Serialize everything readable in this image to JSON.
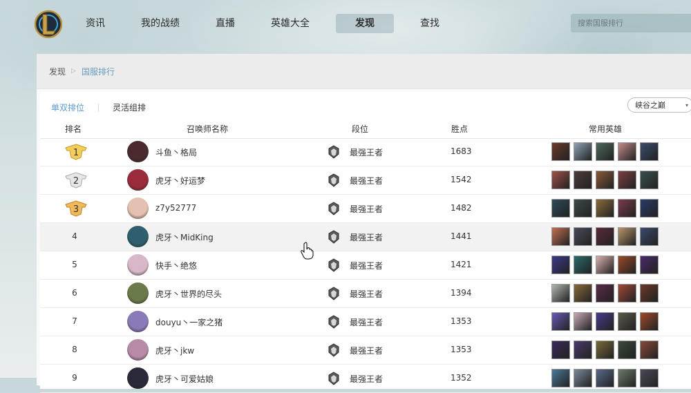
{
  "nav": {
    "items": [
      {
        "label": "资讯"
      },
      {
        "label": "我的战绩"
      },
      {
        "label": "直播"
      },
      {
        "label": "英雄大全"
      },
      {
        "label": "发现",
        "active": true
      },
      {
        "label": "查找"
      }
    ],
    "search_placeholder": "搜索国服排行"
  },
  "breadcrumb": {
    "root": "发现",
    "current": "国服排行"
  },
  "subtabs": [
    {
      "label": "单双排位",
      "active": true
    },
    {
      "label": "灵活组排"
    }
  ],
  "region_select": {
    "value": "峡谷之巅"
  },
  "table": {
    "headers": {
      "rank": "排名",
      "name": "召唤师名称",
      "tier": "段位",
      "points": "胜点",
      "heroes": "常用英雄"
    },
    "rows": [
      {
        "rank": "1",
        "name": "斗鱼丶格局",
        "tier": "最强王者",
        "points": "1683",
        "medal": "gold",
        "avatar": "#4a2a2e",
        "heroes": [
          "#6b3a2a",
          "#8fa3b5",
          "#4d6a5a",
          "#c38b8a",
          "#3b4c6e"
        ]
      },
      {
        "rank": "2",
        "name": "虎牙丶好运梦",
        "tier": "最强王者",
        "points": "1542",
        "medal": "silver",
        "avatar": "#9b2a3a",
        "heroes": [
          "#a0524a",
          "#4e3b3b",
          "#8a5a3a",
          "#7a4040",
          "#3a5050"
        ]
      },
      {
        "rank": "3",
        "name": "z7y52777",
        "tier": "最强王者",
        "points": "1482",
        "medal": "bronze",
        "avatar": "#e3c0b0",
        "heroes": [
          "#2e4a5a",
          "#3d4a48",
          "#8b6a3a",
          "#7a3a4a",
          "#2a3a6a"
        ]
      },
      {
        "rank": "4",
        "name": "虎牙丶MidKing",
        "tier": "最强王者",
        "points": "1441",
        "avatar": "#2f5f6e",
        "heroes": [
          "#c07050",
          "#4a4a5a",
          "#5a2a3a",
          "#b8946a",
          "#3a4a6e"
        ]
      },
      {
        "rank": "5",
        "name": "快手丶绝悠",
        "tier": "最强王者",
        "points": "1421",
        "avatar": "#d8b8c8",
        "heroes": [
          "#3a3a8a",
          "#2a6a6a",
          "#d8b0b0",
          "#9a4a2a",
          "#4a2a6a"
        ]
      },
      {
        "rank": "6",
        "name": "虎牙丶世界的尽头",
        "tier": "最强王者",
        "points": "1394",
        "avatar": "#6a7a4a",
        "heroes": [
          "#b0b8b0",
          "#8a6a3a",
          "#5a2a4a",
          "#a04a3a",
          "#6a3a2a"
        ]
      },
      {
        "rank": "7",
        "name": "douyu丶一家之猪",
        "tier": "最强王者",
        "points": "1353",
        "avatar": "#8a7ab8",
        "heroes": [
          "#6a5ab8",
          "#c8a8b8",
          "#4a3a8a",
          "#5a5a4a",
          "#a04a2a"
        ]
      },
      {
        "rank": "8",
        "name": "虎牙丶jkw",
        "tier": "最强王者",
        "points": "1353",
        "avatar": "#b88aa8",
        "heroes": [
          "#3a2a5a",
          "#4a3a6a",
          "#7a6a3a",
          "#3a4a3a",
          "#8a4a3a"
        ]
      },
      {
        "rank": "9",
        "name": "虎牙丶可爱姑娘",
        "tier": "最强王者",
        "points": "1352",
        "avatar": "#2a2a3a",
        "heroes": [
          "#4a7a9a",
          "#7a8a9a",
          "#5a6a8a",
          "#6a7a6a",
          "#4a4a5a"
        ]
      }
    ]
  },
  "colors": {
    "accent": "#5b9ad0",
    "gold": "#e1b43a",
    "silver": "#b8b8b8",
    "bronze": "#d19a3a"
  }
}
